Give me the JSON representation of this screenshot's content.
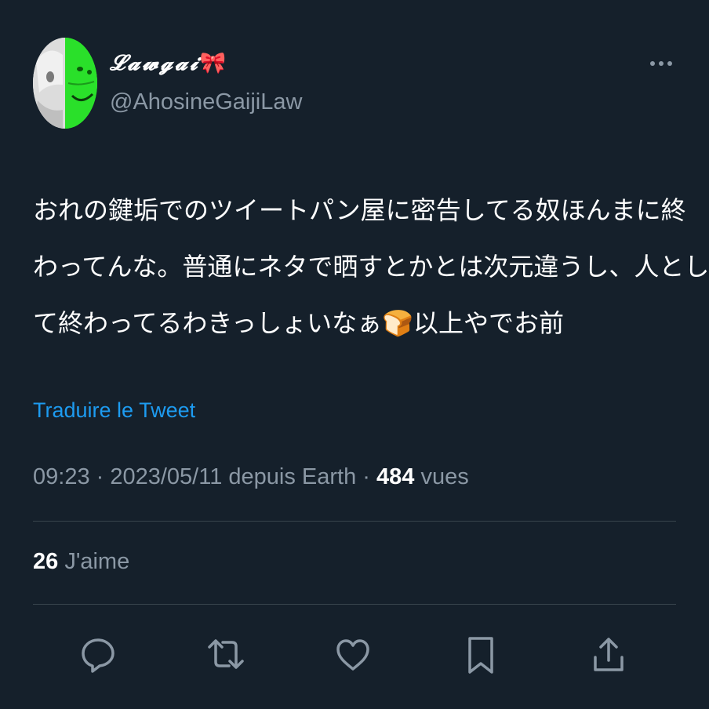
{
  "author": {
    "display_name": "𝓛𝓪𝔀𝓰𝓪𝓲",
    "name_emoji": "🎀",
    "handle": "@AhosineGaijiLaw",
    "avatar": "avatar-image"
  },
  "tweet": {
    "lines": [
      "おれの鍵垢でのツイートパン屋に密告してる奴ほんまに終",
      "わってんな。普通にネタで晒すとかとは次元違うし、人とし",
      "て終わってるわきっしょいなぁ🍞以上やでお前"
    ]
  },
  "translate_label": "Traduire le Tweet",
  "meta": {
    "time": "09:23",
    "separator1": " · ",
    "date": "2023/05/11",
    "source": " depuis Earth",
    "separator2": " · ",
    "views_count": "484",
    "views_label": " vues"
  },
  "likes": {
    "count": "26",
    "label": " J'aime"
  },
  "actions": [
    "reply-icon",
    "retweet-icon",
    "like-icon",
    "bookmark-icon",
    "share-icon"
  ],
  "colors": {
    "background": "#15202b",
    "text": "#ffffff",
    "secondary": "#8b98a5",
    "link": "#1d9bf0",
    "divider": "#38444d"
  }
}
